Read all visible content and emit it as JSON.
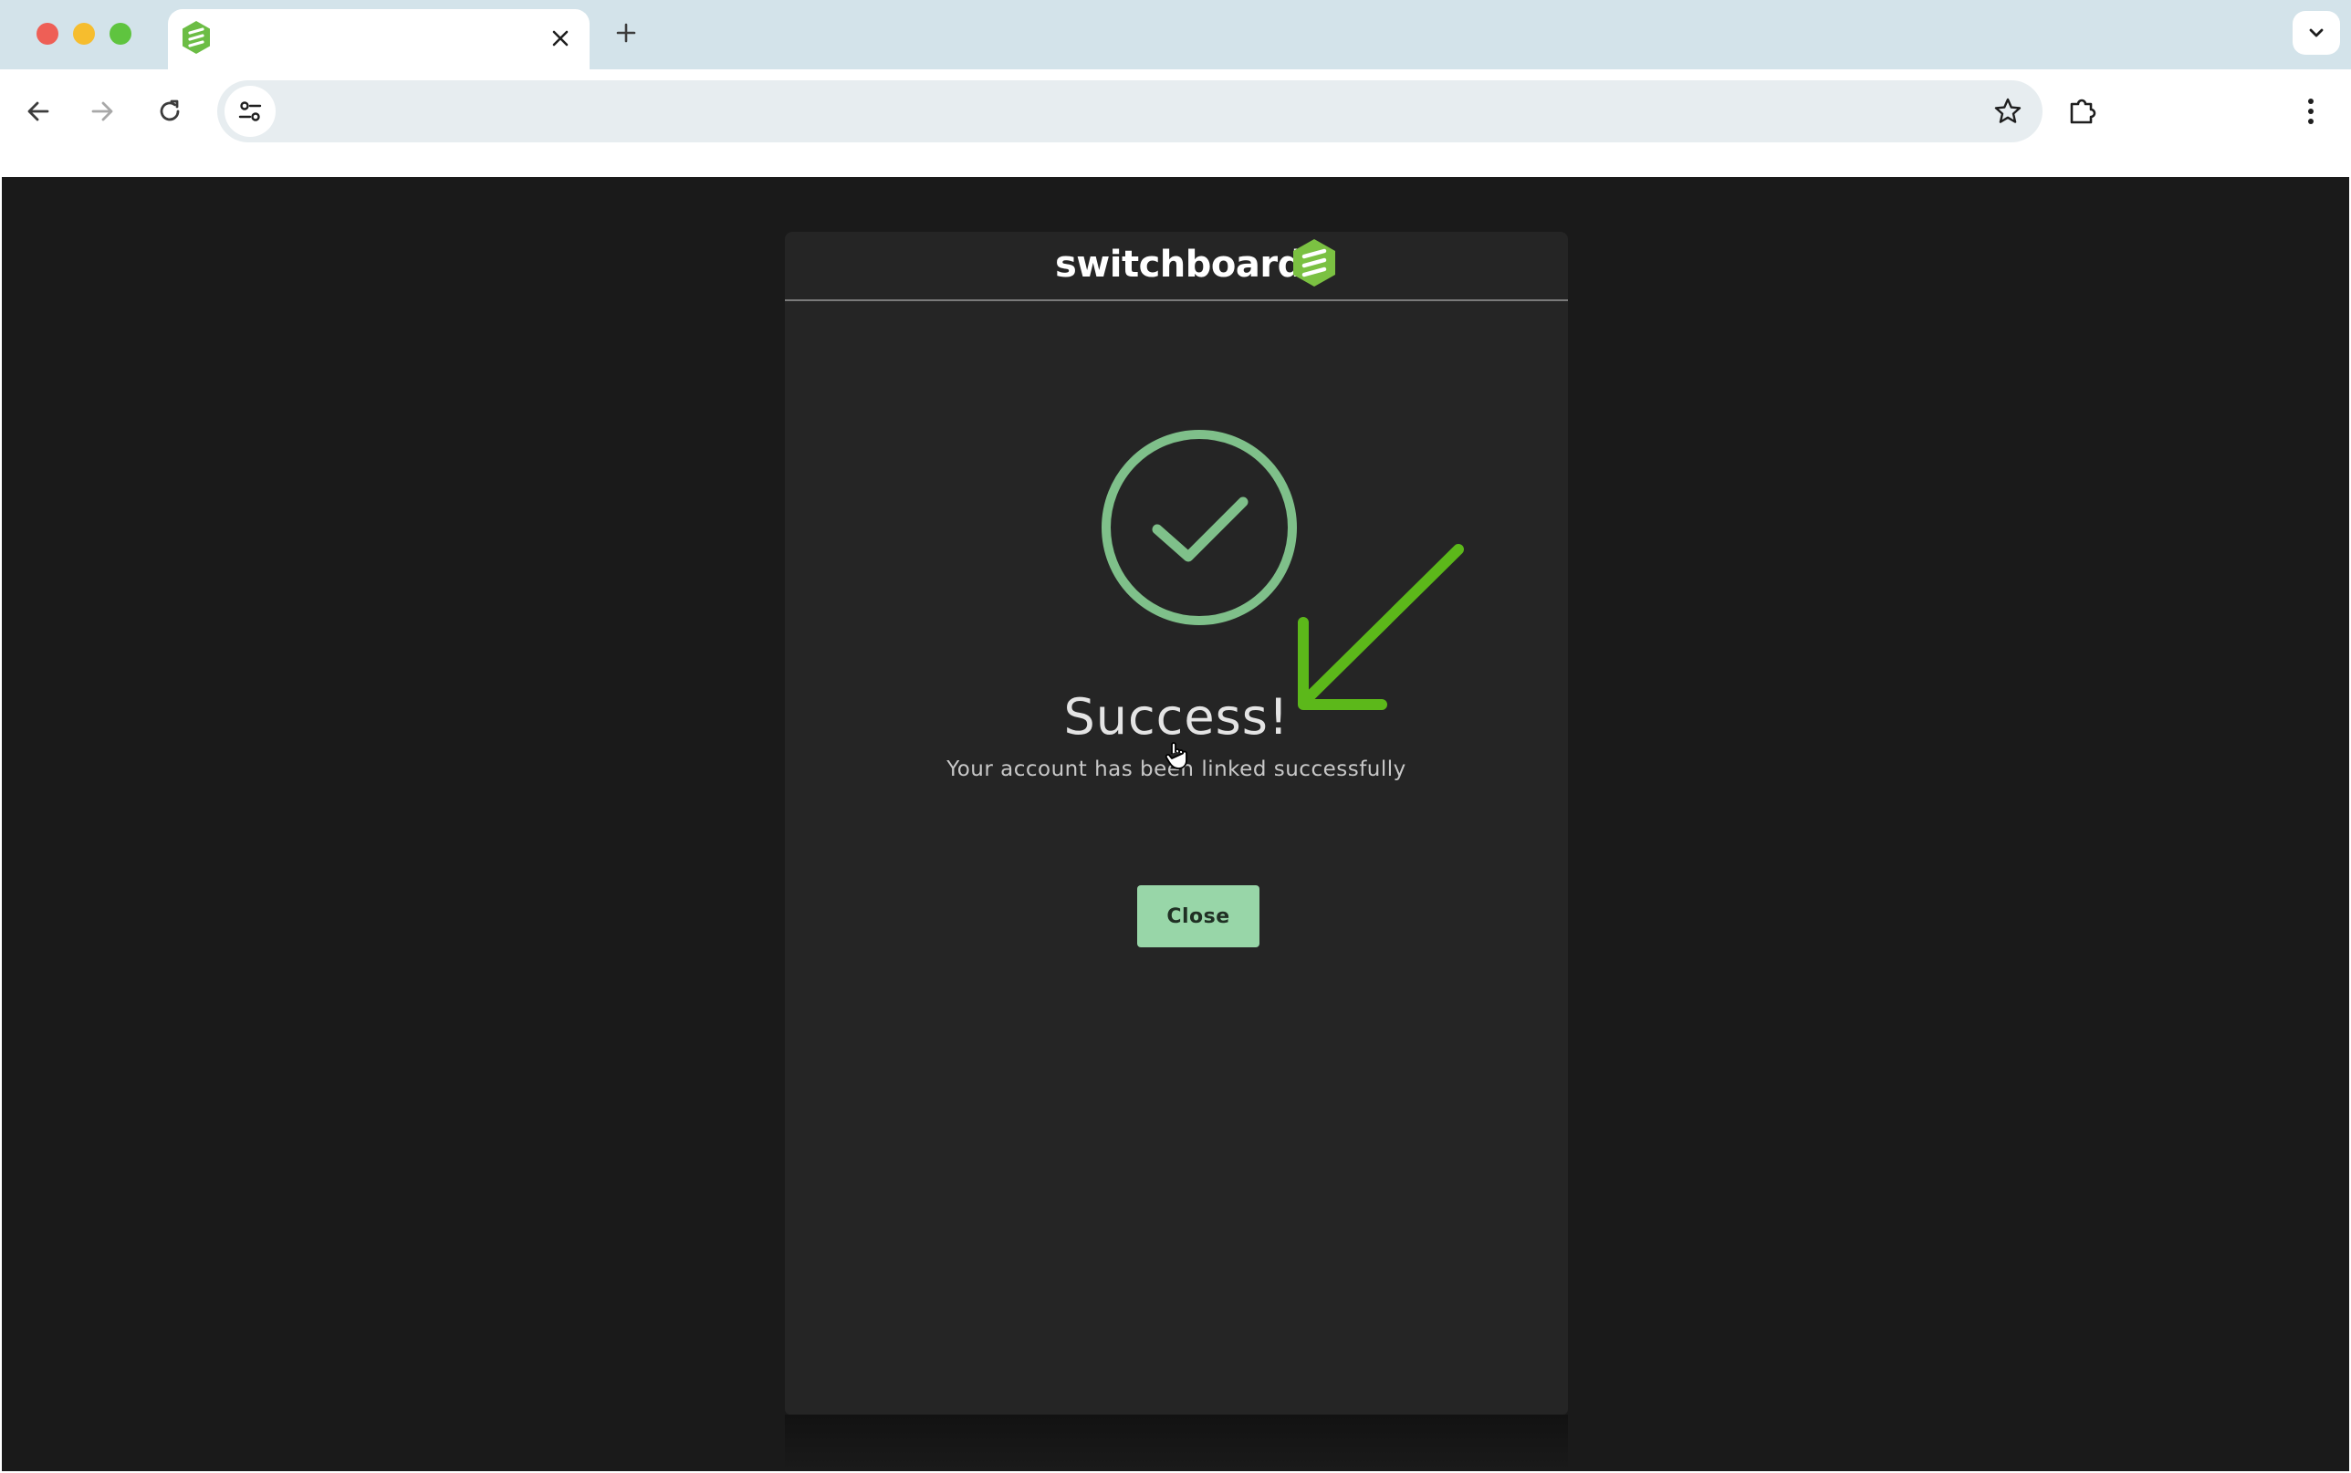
{
  "browser": {
    "tab": {
      "favicon": "switchboard-logo-icon",
      "title": ""
    },
    "icons": {
      "close_tab": "close-icon",
      "new_tab": "plus-icon",
      "tab_search": "chevron-down-icon",
      "back": "arrow-left-icon",
      "forward": "arrow-right-icon",
      "reload": "reload-icon",
      "site_info": "tune-icon",
      "bookmark": "star-icon",
      "extensions": "puzzle-icon",
      "menu": "kebab-menu-icon"
    },
    "address_bar": {
      "value": "",
      "placeholder": ""
    }
  },
  "app": {
    "logo_text": "switchboard",
    "colors": {
      "brand_green": "#7bc142",
      "success_green": "#7fc08a",
      "button_bg": "#98d6a8",
      "annotation_arrow": "#5cb81a"
    },
    "success": {
      "icon": "check-circle-icon",
      "title": "Success!",
      "message": "Your account has been linked successfully"
    },
    "close_button": {
      "label": "Close"
    }
  },
  "annotation": {
    "icon": "green-arrow-icon"
  }
}
